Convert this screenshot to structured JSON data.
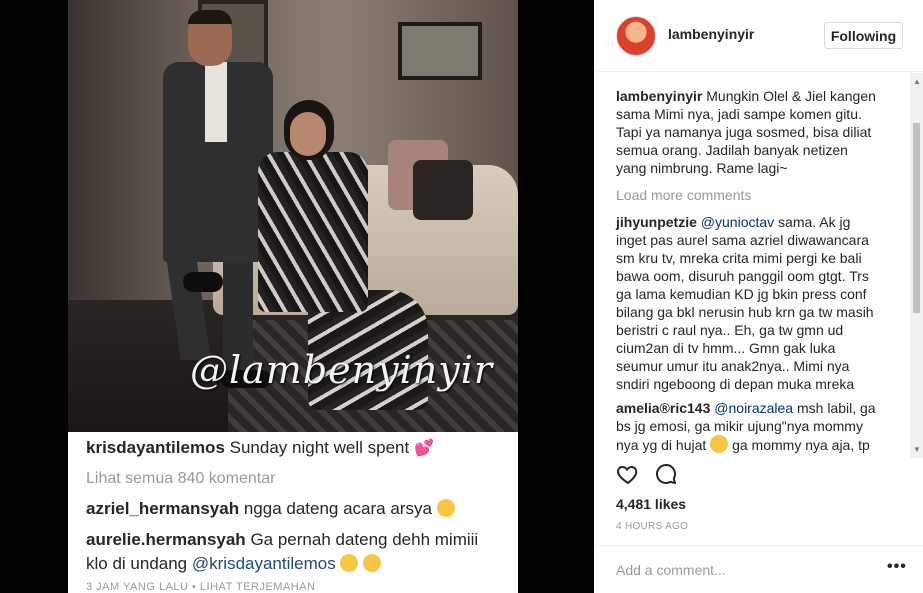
{
  "photo": {
    "watermark": "@lambenyinyir"
  },
  "screenshot_comments": {
    "caption_user": "krisdayantilemos",
    "caption_text": "Sunday night well spent",
    "view_all": "Lihat semua 840 komentar",
    "c1_user": "azriel_hermansyah",
    "c1_text": "ngga dateng acara arsya",
    "c2_user": "aurelie.hermansyah",
    "c2_text_1": "Ga pernah dateng dehh mimiii",
    "c2_text_2": "klo di undang",
    "c2_mention": "@krisdayantilemos",
    "time": "3 JAM YANG LALU • LIHAT TERJEMAHAN"
  },
  "header": {
    "username": "lambenyinyir",
    "follow_label": "Following"
  },
  "comments": {
    "caption": {
      "user": "lambenyinyir",
      "text": "Mungkin Olel & Jiel kangen sama Mimi nya, jadi sampe komen gitu. Tapi ya namanya juga sosmed, bisa diliat semua orang. Jadilah banyak netizen yang nimbrung. Rame lagi~"
    },
    "load_more": "Load more comments",
    "c1": {
      "user": "jihyunpetzie",
      "mention": "@yunioctav",
      "text": "sama. Ak jg inget pas aurel sama azriel diwawancara sm kru tv, mreka crita mimi pergi ke bali bawa oom, disuruh panggil oom gtgt. Trs ga lama kemudian KD jg bkin press conf bilang ga bkl nerusin hub krn ga tw masih beristri c raul nya.. Eh, ga tw gmn ud cium2an di tv hmm... Gmn gak luka seumur umur itu anak2nya.. Mimi nya sndiri ngeboong di depan muka mreka"
    },
    "c2": {
      "user": "amelia®ric143",
      "mention": "@noirazalea",
      "text_1": "msh labil, ga bs jg emosi, ga mikir ujung\"nya mommy nya yg di hujat",
      "text_2": "ga mommy nya aja, tp"
    }
  },
  "stats": {
    "likes": "4,481 likes",
    "timestamp": "4 HOURS AGO"
  },
  "composer": {
    "placeholder": "Add a comment...",
    "more": "•••"
  }
}
